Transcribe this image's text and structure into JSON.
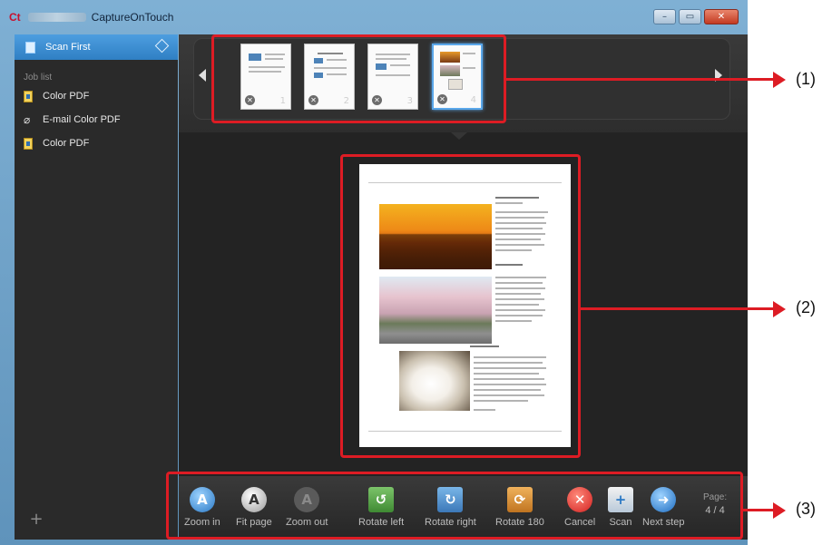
{
  "window": {
    "app_logo": "Ct",
    "title": "CaptureOnTouch",
    "controls": {
      "minimize": "–",
      "maximize": "▭",
      "close": "✕"
    }
  },
  "sidebar": {
    "scan_first": "Scan First",
    "job_list_heading": "Job list",
    "jobs": [
      {
        "label": "Color PDF",
        "icon": "pdf-doc-icon"
      },
      {
        "label": "E-mail Color PDF",
        "icon": "paperclip-icon"
      },
      {
        "label": "Color PDF",
        "icon": "pdf-doc-icon"
      }
    ],
    "add_symbol": "+"
  },
  "thumbnails": [
    {
      "number": "1",
      "selected": false
    },
    {
      "number": "2",
      "selected": false
    },
    {
      "number": "3",
      "selected": false
    },
    {
      "number": "4",
      "selected": true
    }
  ],
  "toolbar": {
    "zoom_in": "Zoom in",
    "fit_page": "Fit page",
    "zoom_out": "Zoom out",
    "rotate_left": "Rotate left",
    "rotate_right": "Rotate right",
    "rotate_180": "Rotate 180",
    "cancel": "Cancel",
    "scan": "Scan",
    "next_step": "Next step",
    "page_label": "Page:",
    "page_value": "4 / 4"
  },
  "callouts": [
    "(1)",
    "(2)",
    "(3)"
  ],
  "colors": {
    "callout": "#dd1c24",
    "accent": "#3d8fd6",
    "panel": "#232323"
  }
}
